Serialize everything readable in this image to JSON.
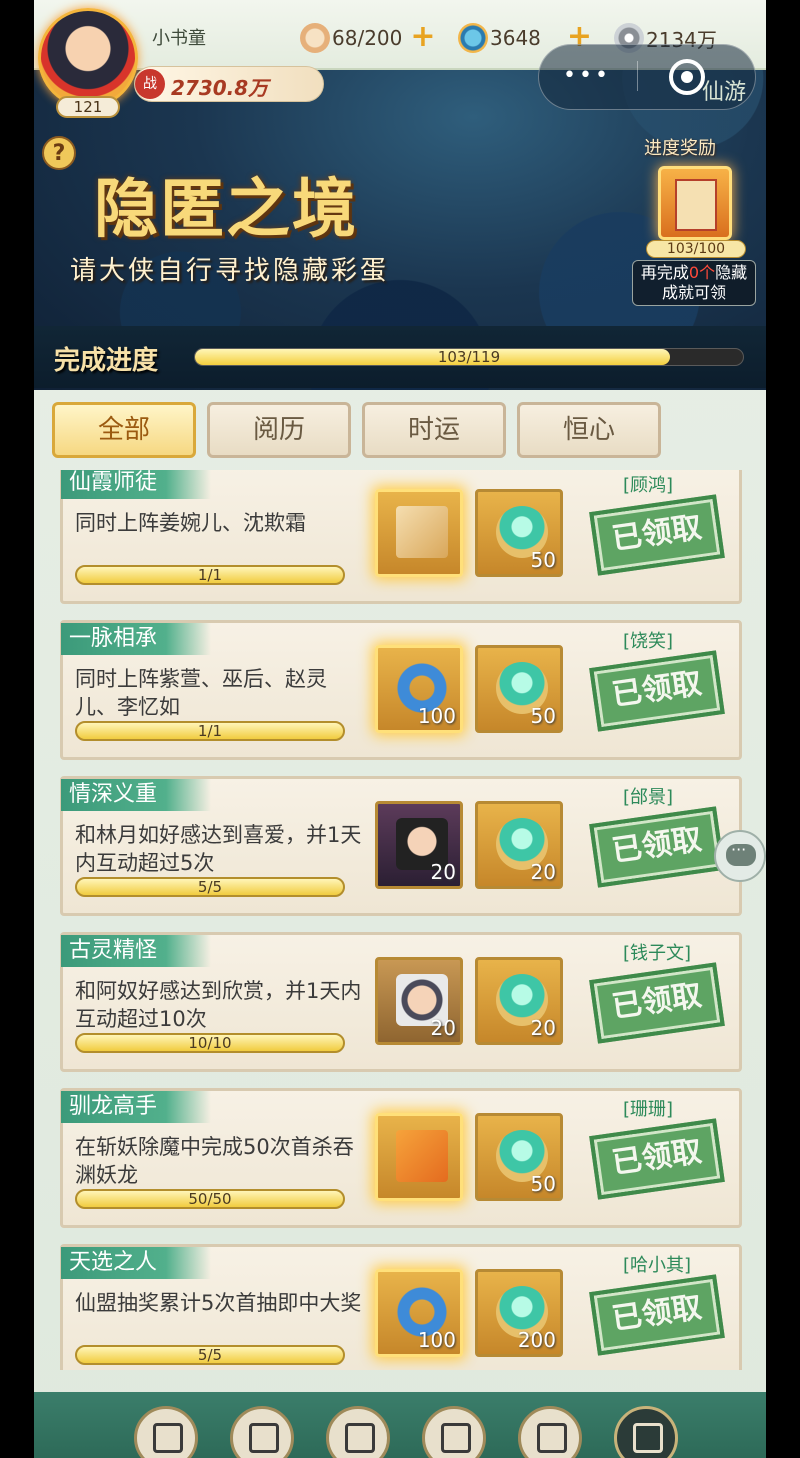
{
  "player": {
    "name": "小书童",
    "level": "121",
    "power_label": "战",
    "power": "2730.8万"
  },
  "resources": [
    {
      "icon": "bun-icon",
      "value": "68/200"
    },
    {
      "icon": "swirl-energy-icon",
      "value": "3648"
    },
    {
      "icon": "coin-icon",
      "value": "2134万"
    }
  ],
  "header": {
    "app_name": "仙游",
    "title": "隐匿之境",
    "subtitle": "请大侠自行寻找隐藏彩蛋",
    "reward_label": "进度奖励",
    "reward_progress": "103/100",
    "reward_note_prefix": "再完成",
    "reward_note_count": "0个",
    "reward_note_suffix": "隐藏成就可领",
    "progress_label": "完成进度",
    "progress_text": "103/119",
    "progress_value": 0.866
  },
  "tabs": [
    {
      "label": "全部",
      "active": true
    },
    {
      "label": "阅历",
      "active": false
    },
    {
      "label": "时运",
      "active": false
    },
    {
      "label": "恒心",
      "active": false
    }
  ],
  "claimed_label": "已领取",
  "tasks": [
    {
      "title": "仙霞师徒",
      "desc": "同时上阵姜婉儿、沈欺霜",
      "progress": "1/1",
      "npc": "[顾鸿]",
      "reward1": {
        "kind": "scroll",
        "count": ""
      },
      "reward2": {
        "kind": "jade",
        "count": "50"
      }
    },
    {
      "title": "一脉相承",
      "desc": "同时上阵紫萱、巫后、赵灵儿、李忆如",
      "progress": "1/1",
      "npc": "[饶笑]",
      "reward1": {
        "kind": "ring",
        "count": "100"
      },
      "reward2": {
        "kind": "jade",
        "count": "50"
      }
    },
    {
      "title": "情深义重",
      "desc": "和林月如好感达到喜爱，并1天内互动超过5次",
      "progress": "5/5",
      "npc": "[邰景]",
      "reward1": {
        "kind": "girl1",
        "count": "20"
      },
      "reward2": {
        "kind": "jade",
        "count": "20"
      }
    },
    {
      "title": "古灵精怪",
      "desc": "和阿奴好感达到欣赏，并1天内互动超过10次",
      "progress": "10/10",
      "npc": "[钱子文]",
      "reward1": {
        "kind": "girl2",
        "count": "20"
      },
      "reward2": {
        "kind": "jade",
        "count": "20"
      }
    },
    {
      "title": "驯龙高手",
      "desc": "在斩妖除魔中完成50次首杀吞渊妖龙",
      "progress": "50/50",
      "npc": "[珊珊]",
      "reward1": {
        "kind": "ticket",
        "count": ""
      },
      "reward2": {
        "kind": "jade",
        "count": "50"
      }
    },
    {
      "title": "天选之人",
      "desc": "仙盟抽奖累计5次首抽即中大奖",
      "progress": "5/5",
      "npc": "[哈小其]",
      "reward1": {
        "kind": "ring",
        "count": "100"
      },
      "reward2": {
        "kind": "jade",
        "count": "200"
      }
    }
  ],
  "bottom_nav": [
    {
      "icon": "daily-book-icon"
    },
    {
      "icon": "weekly-book-icon"
    },
    {
      "icon": "scroll-menu-icon"
    },
    {
      "icon": "companions-icon"
    },
    {
      "icon": "gift-icon"
    },
    {
      "icon": "achievement-book-icon"
    }
  ]
}
